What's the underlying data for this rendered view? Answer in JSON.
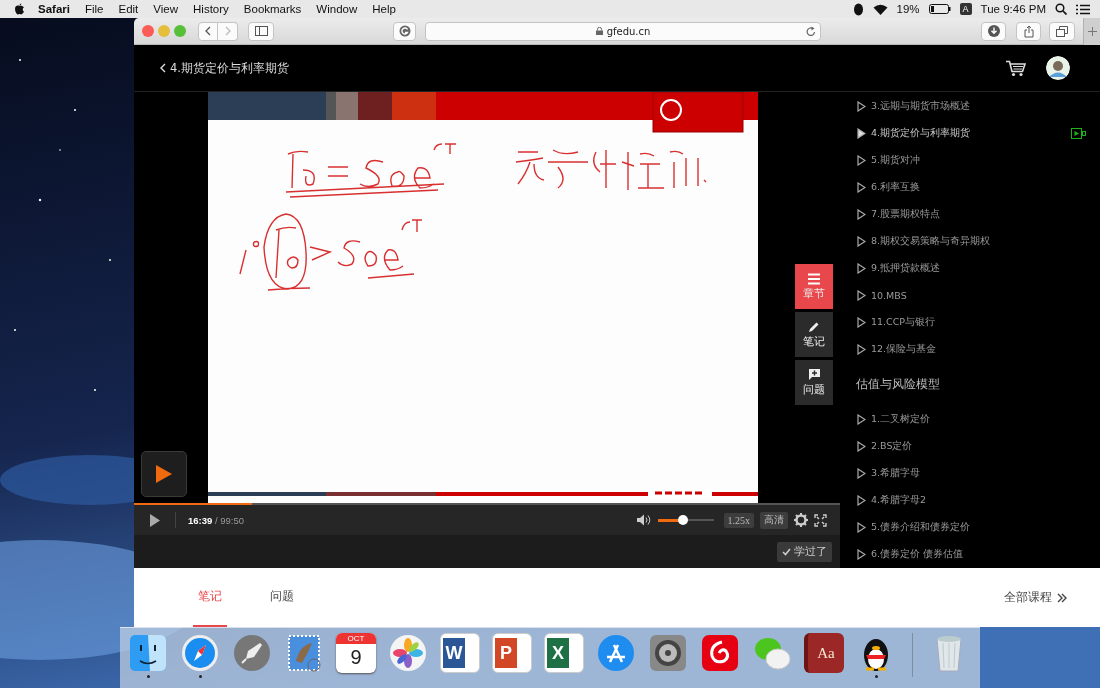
{
  "menu_bar": {
    "app": "Safari",
    "menus": [
      "File",
      "Edit",
      "View",
      "History",
      "Bookmarks",
      "Window",
      "Help"
    ],
    "battery": "19%",
    "input_source": "A",
    "clock": "Tue 9:46 PM"
  },
  "browser": {
    "address": "gfedu.cn"
  },
  "page": {
    "back_title": "4.期货定价与利率期货"
  },
  "player": {
    "progress": {
      "level": 0.167
    },
    "time": "**16:39** / 99:50",
    "volume": {
      "level": 0.46
    },
    "speed": "1.25x",
    "quality": "高清",
    "done_button": "学过了",
    "side_buttons": [
      {
        "label": "章节",
        "kind": "menu",
        "selected": true
      },
      {
        "label": "笔记",
        "kind": "pen",
        "selected": false
      },
      {
        "label": "问题",
        "kind": "question",
        "selected": false
      }
    ]
  },
  "sidebar": {
    "lessons": [
      {
        "title": "3.远期与期货市场概述",
        "selected": false
      },
      {
        "title": "4.期货定价与利率期货",
        "selected": true
      },
      {
        "title": "5.期货对冲",
        "selected": false
      },
      {
        "title": "6.利率互换",
        "selected": false
      },
      {
        "title": "7.股票期权特点",
        "selected": false
      },
      {
        "title": "8.期权交易策略与奇异期权",
        "selected": false
      },
      {
        "title": "9.抵押贷款概述",
        "selected": false
      },
      {
        "title": "10.MBS",
        "selected": false
      },
      {
        "title": "11.CCP与银行",
        "selected": false
      },
      {
        "title": "12.保险与基金",
        "selected": false
      }
    ],
    "sections": [
      {
        "title": "估值与风险模型",
        "lessons": [
          {
            "title": "1.二叉树定价",
            "selected": false
          },
          {
            "title": "2.BS定价",
            "selected": false
          },
          {
            "title": "3.希腊字母",
            "selected": false
          },
          {
            "title": "4.希腊字母2",
            "selected": false
          },
          {
            "title": "5.债券介绍和债券定价",
            "selected": false
          },
          {
            "title": "6.债券定价 债券估值",
            "selected": false
          }
        ]
      }
    ]
  },
  "tabs": [
    {
      "label": "笔记",
      "selected": true
    },
    {
      "label": "问题",
      "selected": false
    }
  ],
  "all_courses": "全部课程",
  "dock": [
    {
      "kind": "finder",
      "running": true
    },
    {
      "kind": "safari",
      "running": true
    },
    {
      "kind": "launchpad",
      "running": false
    },
    {
      "kind": "mail",
      "running": false
    },
    {
      "kind": "calendar",
      "month": "OCT",
      "day": "9",
      "running": false
    },
    {
      "kind": "photos",
      "running": false
    },
    {
      "kind": "word",
      "glyph": "W",
      "running": false
    },
    {
      "kind": "powerpoint",
      "glyph": "P",
      "running": false
    },
    {
      "kind": "excel",
      "glyph": "X",
      "running": false
    },
    {
      "kind": "appstore",
      "running": false
    },
    {
      "kind": "settings",
      "running": false
    },
    {
      "kind": "music",
      "running": false
    },
    {
      "kind": "wechat",
      "running": false
    },
    {
      "kind": "dictionary",
      "glyph": "Aa",
      "running": false
    },
    {
      "kind": "qq",
      "running": true
    },
    {
      "kind": "trash",
      "running": false
    }
  ]
}
